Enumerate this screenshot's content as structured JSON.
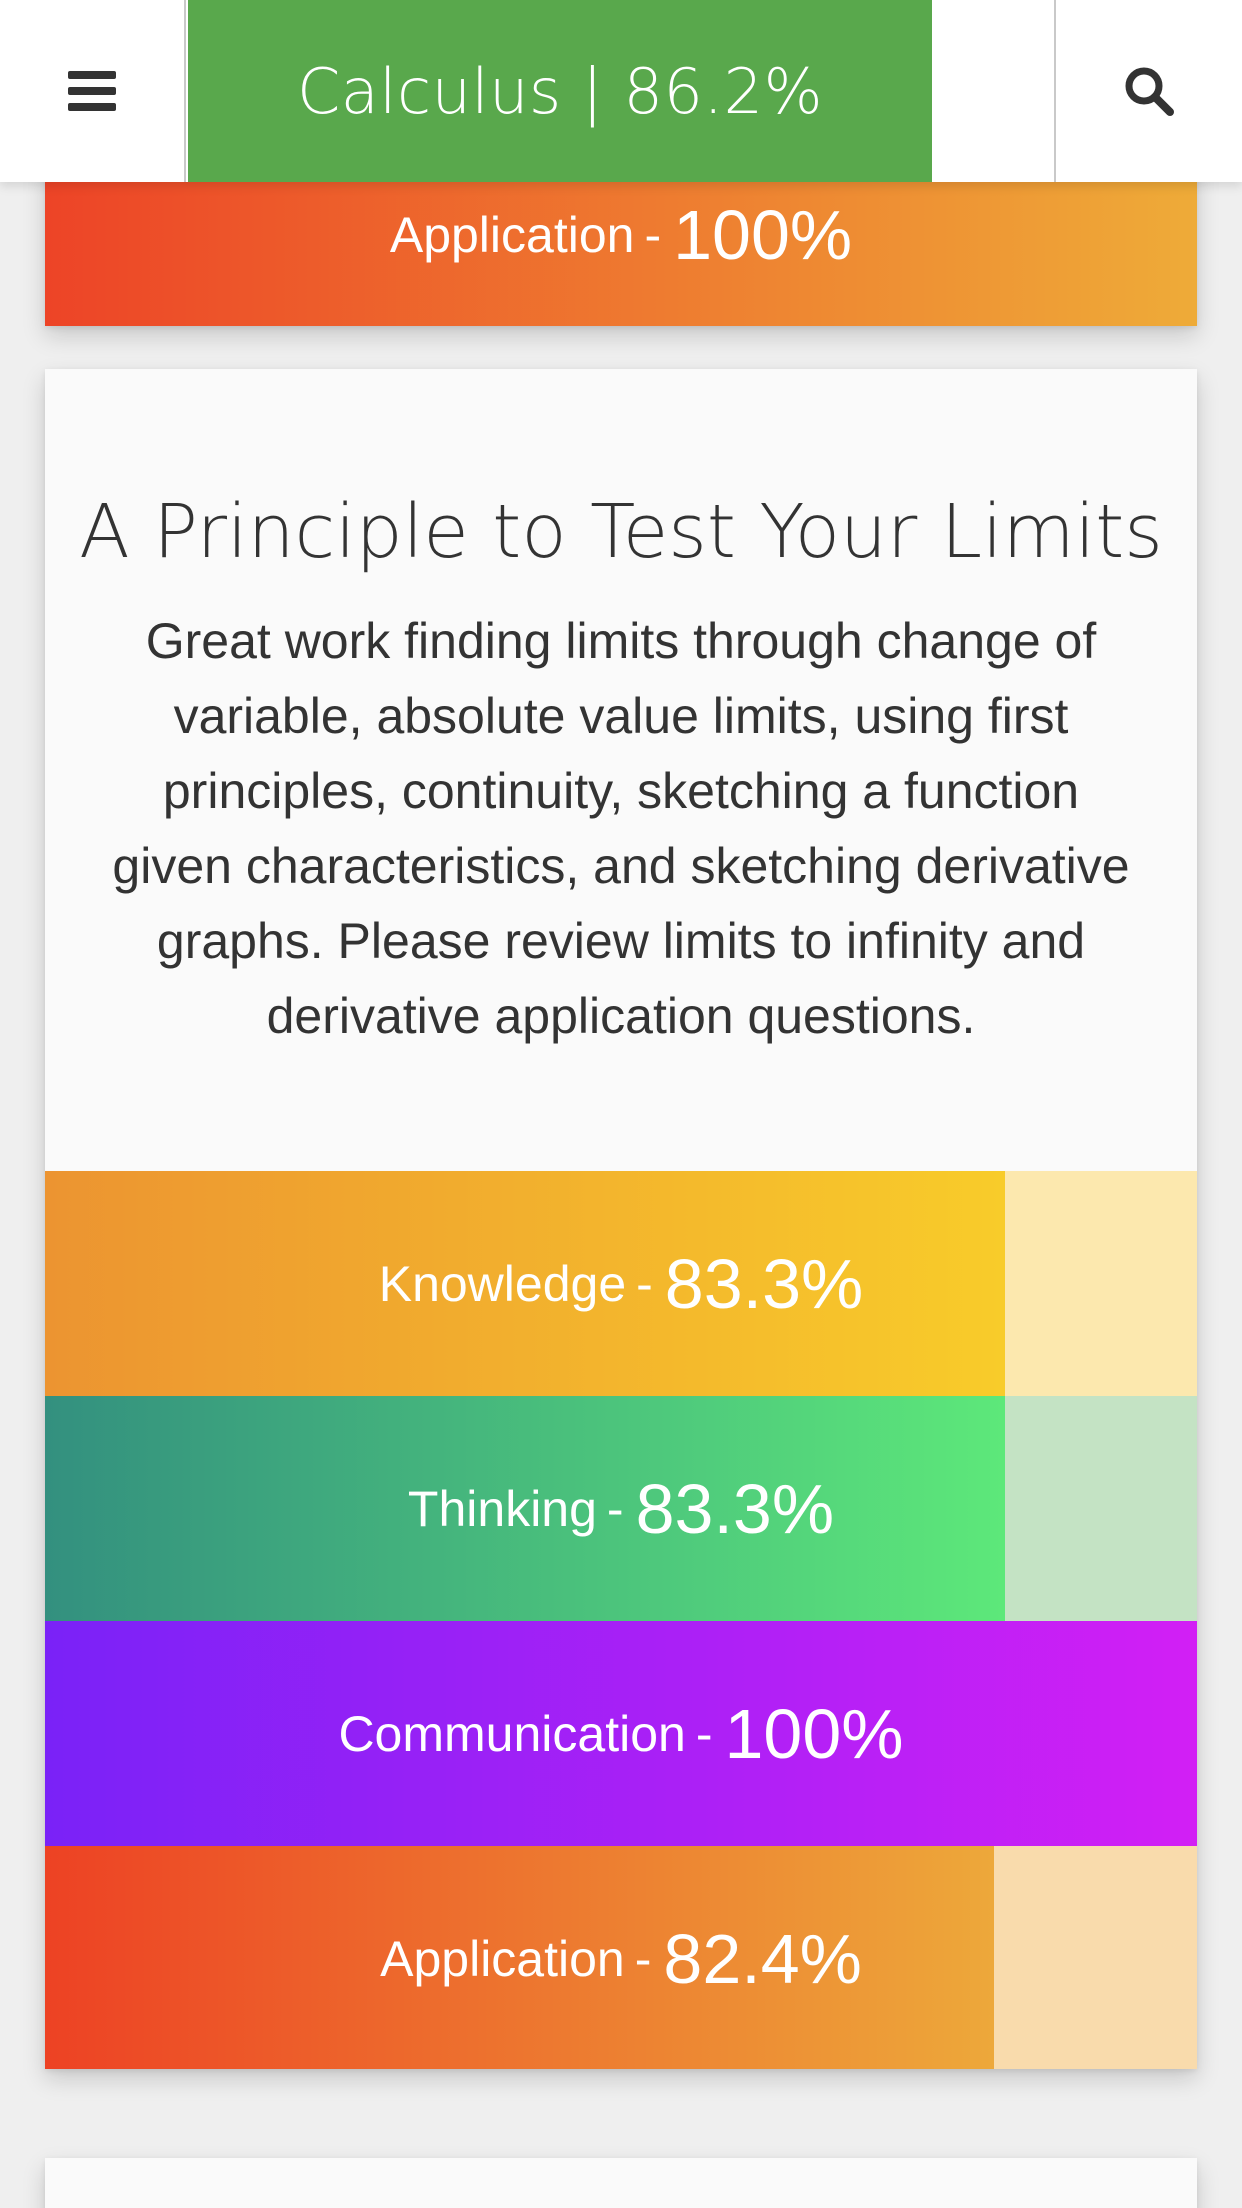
{
  "header": {
    "menu_icon": "menu-icon",
    "title": "Calculus | 86.2%",
    "search_icon": "search-icon",
    "title_bg": "#59a84c"
  },
  "top_card": {
    "bar": {
      "name": "Application",
      "separator": "-",
      "value": "100%"
    }
  },
  "summary_card": {
    "title": "A Principle to Test Your Limits",
    "body": "Great work finding limits through change of variable, absolute value limits, using first principles, continuity, sketching a function given characteristics, and sketching derivative graphs. Please review limits to infinity and derivative application questions.",
    "bars": [
      {
        "name": "Knowledge",
        "separator": "-",
        "value": "83.3%",
        "percent": 83.3
      },
      {
        "name": "Thinking",
        "separator": "-",
        "value": "83.3%",
        "percent": 83.3
      },
      {
        "name": "Communication",
        "separator": "-",
        "value": "100%",
        "percent": 100
      },
      {
        "name": "Application",
        "separator": "-",
        "value": "82.4%",
        "percent": 82.4
      }
    ]
  },
  "colors": {
    "knowledge": [
      "#ec9431",
      "#f8cc2a"
    ],
    "thinking": [
      "#33907f",
      "#5de87a"
    ],
    "communication": [
      "#7a22f7",
      "#d21ff5"
    ],
    "application": [
      "#ed4224",
      "#eda83a"
    ]
  }
}
